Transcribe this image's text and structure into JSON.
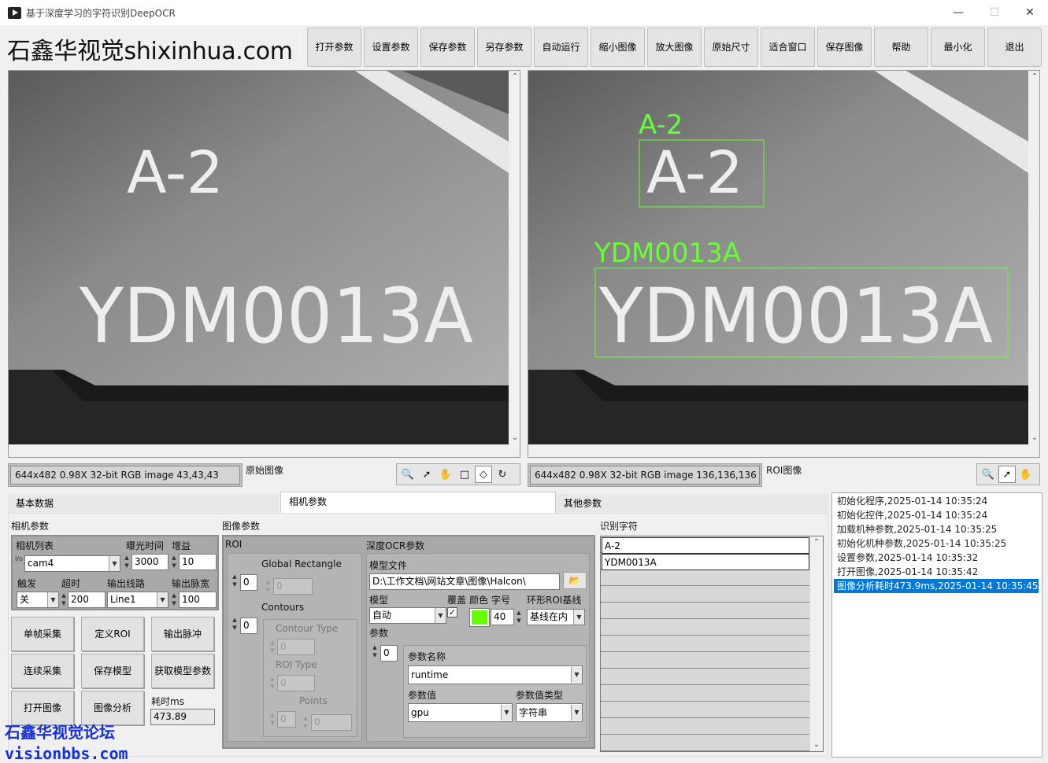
{
  "window": {
    "title": "基于深度学习的字符识别DeepOCR",
    "controls": [
      "—",
      "☐",
      "✕"
    ]
  },
  "brand": "石鑫华视觉shixinhua.com",
  "toolbar": [
    "打开参数",
    "设置参数",
    "保存参数",
    "另存参数",
    "自动运行",
    "缩小图像",
    "放大图像",
    "原始尺寸",
    "适合窗口",
    "保存图像",
    "帮助",
    "最小化",
    "退出"
  ],
  "left_view": {
    "text_line1": "A-2",
    "text_line2": "YDM0013A",
    "status": "644x482 0.98X 32-bit RGB image 43,43,43",
    "label": "原始图像",
    "tools": [
      "zoom-icon",
      "pointer-icon",
      "pan-icon",
      "rect-icon",
      "diamond-icon",
      "rotate-icon"
    ]
  },
  "right_view": {
    "text_line1": "A-2",
    "text_line2": "YDM0013A",
    "overlay1": "A-2",
    "overlay2": "YDM0013A",
    "overlay_color": "#66ff33",
    "status": "644x482 0.98X 32-bit RGB image 136,136,136",
    "label": "ROI图像",
    "tools": [
      "zoom-icon",
      "pointer-icon",
      "pan-icon"
    ]
  },
  "tabs": [
    "基本数据",
    "相机参数",
    "其他参数"
  ],
  "camera": {
    "group_label": "相机参数",
    "list_label": "相机列表",
    "exposure_label": "曝光时间",
    "gain_label": "增益",
    "camera_value": "cam4",
    "exposure_value": "3000",
    "gain_value": "10",
    "trigger_label": "触发",
    "timeout_label": "超时",
    "line_label": "输出线路",
    "pulse_label": "输出脉宽",
    "trigger_value": "关",
    "timeout_value": "200",
    "line_value": "Line1",
    "pulse_value": "100",
    "io_glyph": "I/o"
  },
  "buttons": [
    "单帧采集",
    "定义ROI",
    "输出脉冲",
    "连续采集",
    "保存模型",
    "获取模型参数",
    "打开图像",
    "图像分析"
  ],
  "elapsed": {
    "label": "耗时ms",
    "value": "473.89"
  },
  "image_params": {
    "group_label": "图像参数",
    "roi_label": "ROI",
    "global_rect": "Global Rectangle",
    "contours": "Contours",
    "contour_type": "Contour Type",
    "roi_type": "ROI Type",
    "points": "Points",
    "idx1": "0",
    "idx2": "0",
    "dis1": "0",
    "dis2": "0",
    "dis3": "0",
    "dis4": "0",
    "dis5": "0"
  },
  "ocr": {
    "group_label": "深度OCR参数",
    "model_file_label": "模型文件",
    "model_file_value": "D:\\工作文档\\网站文章\\图像\\Halcon\\",
    "model_label": "模型",
    "model_value": "自动",
    "overlay_label": "覆盖",
    "color_label": "颜色",
    "color_value": "#66ff00",
    "font_label": "字号",
    "font_value": "40",
    "ring_label": "环形ROI基线",
    "ring_value": "基线在内",
    "param_label": "参数",
    "param_index": "0",
    "param_name_label": "参数名称",
    "param_name_value": "runtime",
    "param_value_label": "参数值",
    "param_value": "gpu",
    "param_type_label": "参数值类型",
    "param_type_value": "字符串"
  },
  "recognized": {
    "label": "识别字符",
    "items": [
      "A-2",
      "YDM0013A"
    ]
  },
  "log": [
    "初始化程序,2025-01-14 10:35:24",
    "初始化控件,2025-01-14 10:35:24",
    "加载机种参数,2025-01-14 10:35:25",
    "初始化机种参数,2025-01-14 10:35:25",
    "设置参数,2025-01-14 10:35:32",
    "打开图像,2025-01-14 10:35:42",
    "图像分析耗时473.9ms,2025-01-14 10:35:45"
  ],
  "watermark": {
    "line1": "石鑫华视觉论坛",
    "line2": "visionbbs.com"
  }
}
